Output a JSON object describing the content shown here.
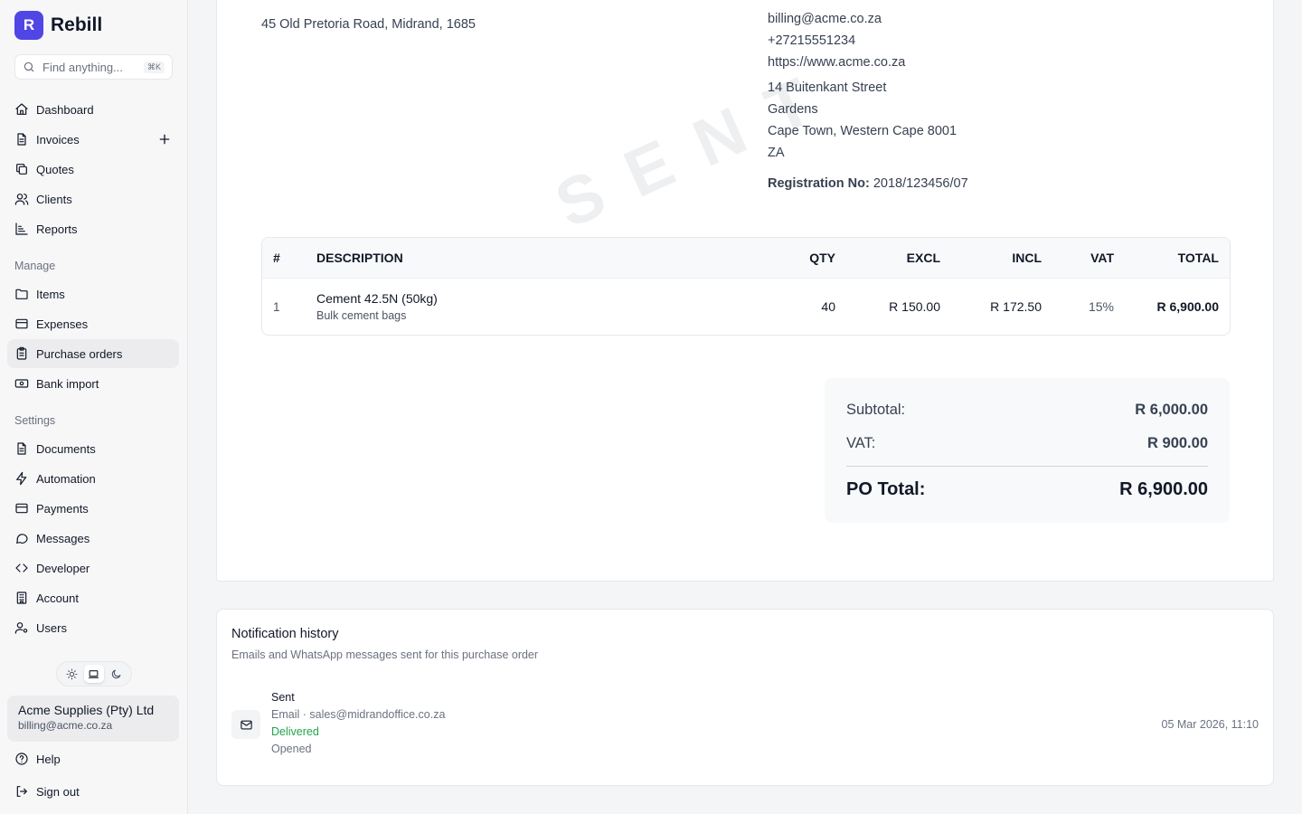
{
  "brand": {
    "logo_letter": "R",
    "name": "Rebill"
  },
  "search": {
    "placeholder": "Find anything...",
    "shortcut": "⌘K"
  },
  "nav": {
    "main": [
      {
        "label": "Dashboard",
        "icon": "home-icon"
      },
      {
        "label": "Invoices",
        "icon": "file-icon",
        "action_icon": "plus-icon"
      },
      {
        "label": "Quotes",
        "icon": "copy-icon"
      },
      {
        "label": "Clients",
        "icon": "users-icon"
      },
      {
        "label": "Reports",
        "icon": "chart-icon"
      }
    ],
    "manage_label": "Manage",
    "manage": [
      {
        "label": "Items",
        "icon": "folder-icon"
      },
      {
        "label": "Expenses",
        "icon": "card-icon"
      },
      {
        "label": "Purchase orders",
        "icon": "clipboard-icon",
        "active": true
      },
      {
        "label": "Bank import",
        "icon": "banknote-icon"
      }
    ],
    "settings_label": "Settings",
    "settings": [
      {
        "label": "Documents",
        "icon": "file-icon"
      },
      {
        "label": "Automation",
        "icon": "bolt-icon"
      },
      {
        "label": "Payments",
        "icon": "card-icon"
      },
      {
        "label": "Messages",
        "icon": "chat-icon"
      },
      {
        "label": "Developer",
        "icon": "code-icon"
      },
      {
        "label": "Account",
        "icon": "building-icon"
      },
      {
        "label": "Users",
        "icon": "user-cog-icon"
      }
    ],
    "help": "Help",
    "signout": "Sign out"
  },
  "theme": {
    "options": [
      "light",
      "system",
      "dark"
    ],
    "selected": "system"
  },
  "account": {
    "name": "Acme Supplies (Pty) Ltd",
    "email": "billing@acme.co.za"
  },
  "document": {
    "from_address": "45 Old Pretoria Road, Midrand, 1685",
    "watermark": "SENT",
    "company": {
      "email": "billing@acme.co.za",
      "phone": "+27215551234",
      "website": "https://www.acme.co.za",
      "street": "14 Buitenkant Street",
      "suburb": "Gardens",
      "city": "Cape Town, Western Cape 8001",
      "country": "ZA",
      "reg_label": "Registration No:",
      "reg_value": "2018/123456/07"
    },
    "table": {
      "headers": [
        "#",
        "DESCRIPTION",
        "QTY",
        "EXCL",
        "INCL",
        "VAT",
        "TOTAL"
      ],
      "rows": [
        {
          "num": "1",
          "name": "Cement 42.5N (50kg)",
          "note": "Bulk cement bags",
          "qty": "40",
          "excl": "R 150.00",
          "incl": "R 172.50",
          "vat": "15%",
          "total": "R 6,900.00"
        }
      ]
    },
    "totals": {
      "subtotal_label": "Subtotal:",
      "subtotal": "R 6,000.00",
      "vat_label": "VAT:",
      "vat": "R 900.00",
      "total_label": "PO Total:",
      "total": "R 6,900.00"
    }
  },
  "notifications": {
    "title": "Notification history",
    "subtitle": "Emails and WhatsApp messages sent for this purchase order",
    "items": [
      {
        "status": "Sent",
        "channel": "Email · sales@midrandoffice.co.za",
        "delivery": "Delivered",
        "opened": "Opened",
        "time": "05 Mar 2026, 11:10",
        "icon": "mail-icon"
      }
    ]
  },
  "colors": {
    "brand": "#4f46e5",
    "delivered": "#22a34a",
    "active_nav_bg": "#ececee"
  }
}
